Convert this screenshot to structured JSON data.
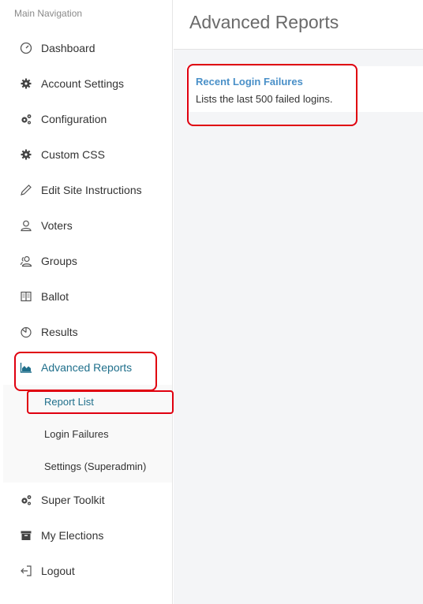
{
  "sidebar": {
    "heading": "Main Navigation",
    "items": [
      {
        "label": "Dashboard",
        "icon": "gauge-icon"
      },
      {
        "label": "Account Settings",
        "icon": "gear-icon"
      },
      {
        "label": "Configuration",
        "icon": "gears-icon"
      },
      {
        "label": "Custom CSS",
        "icon": "gear-icon"
      },
      {
        "label": "Edit Site Instructions",
        "icon": "pencil-icon"
      },
      {
        "label": "Voters",
        "icon": "user-icon"
      },
      {
        "label": "Groups",
        "icon": "users-icon"
      },
      {
        "label": "Ballot",
        "icon": "book-icon"
      },
      {
        "label": "Results",
        "icon": "pie-chart-icon"
      },
      {
        "label": "Advanced Reports",
        "icon": "area-chart-icon"
      },
      {
        "label": "Super Toolkit",
        "icon": "gears-icon"
      },
      {
        "label": "My Elections",
        "icon": "archive-icon"
      },
      {
        "label": "Logout",
        "icon": "sign-out-icon"
      }
    ],
    "submenu": [
      {
        "label": "Report List"
      },
      {
        "label": "Login Failures"
      },
      {
        "label": "Settings (Superadmin)"
      }
    ]
  },
  "main": {
    "title": "Advanced Reports",
    "reports": [
      {
        "title": "Recent Login Failures",
        "description": "Lists the last 500 failed logins."
      }
    ]
  },
  "colors": {
    "active": "#1f6f8b",
    "link": "#4a90c8",
    "annotation": "#e0000f"
  }
}
